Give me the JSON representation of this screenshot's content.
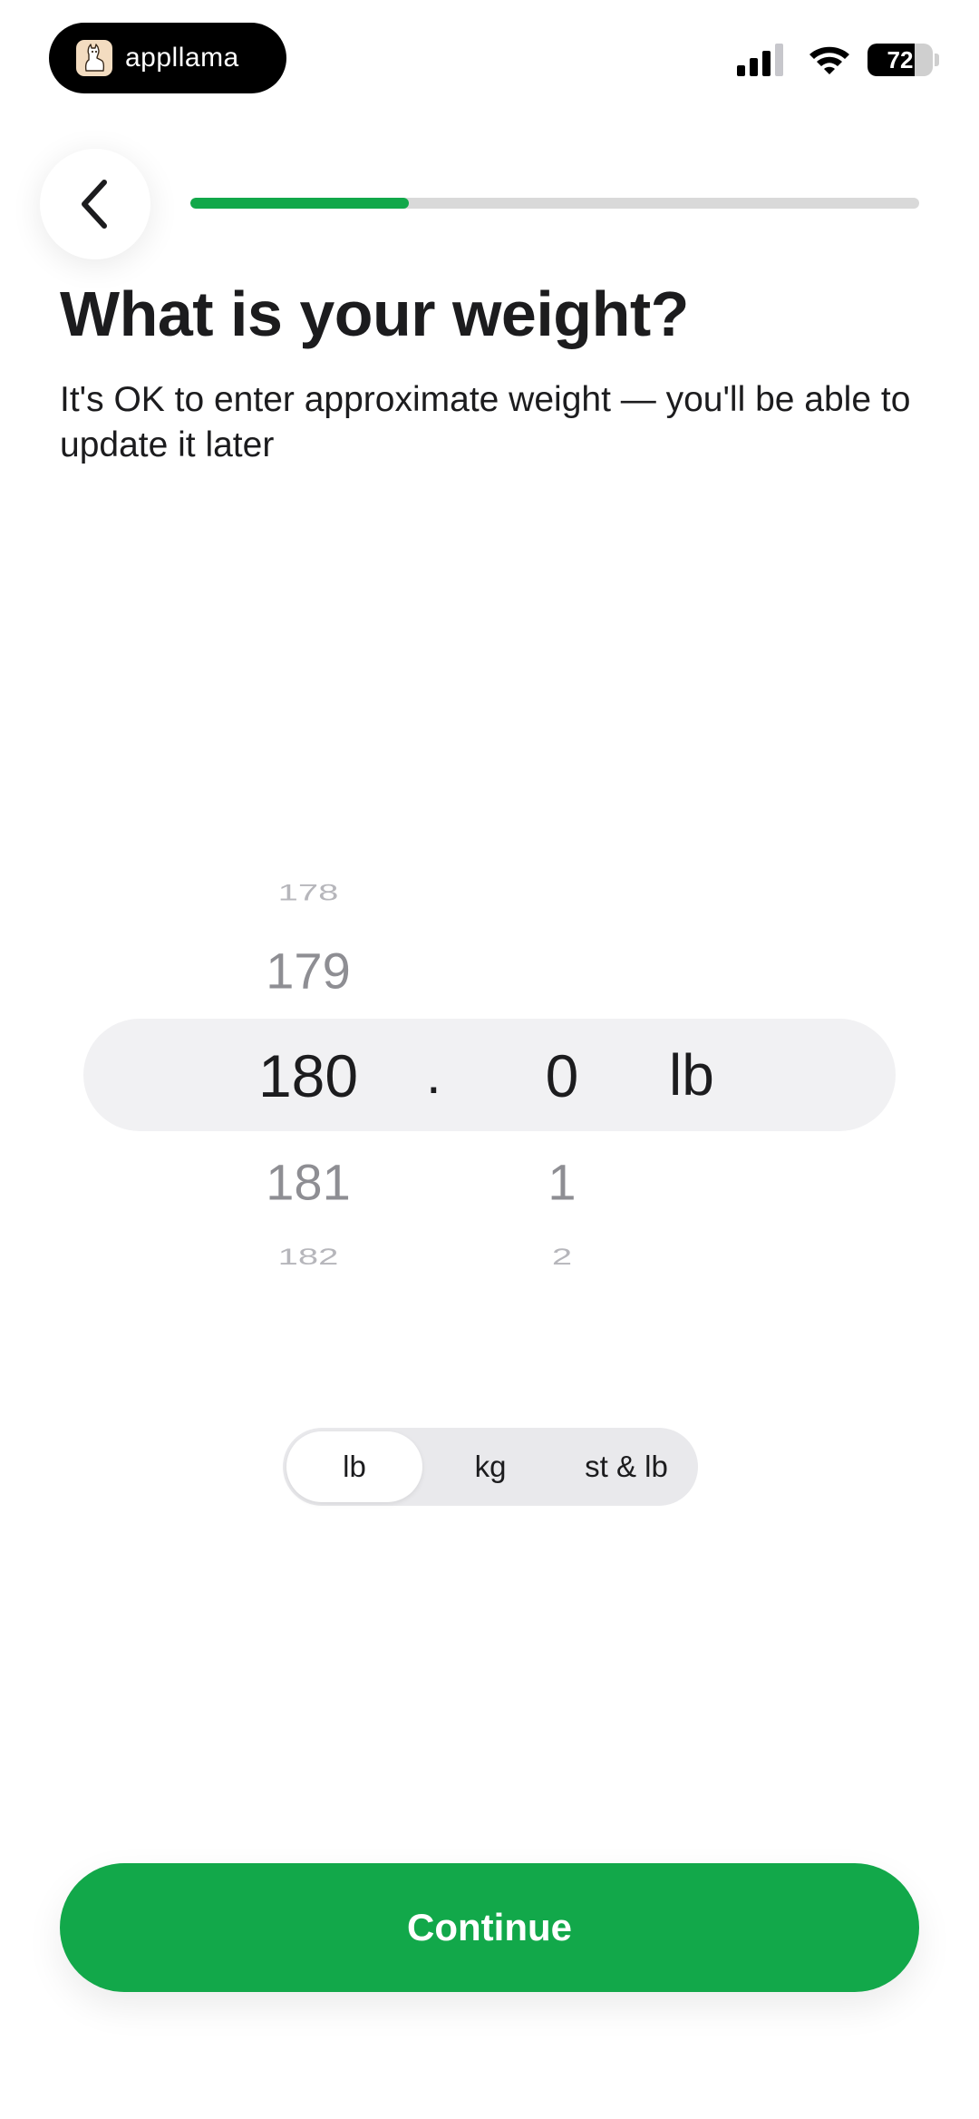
{
  "status_bar": {
    "app_badge": "appllama",
    "battery": "72",
    "battery_level_percent": 72,
    "icons": [
      "llama-logo-icon",
      "signal-icon",
      "wifi-icon",
      "battery-icon"
    ]
  },
  "header": {
    "back_icon": "chevron-left-icon",
    "progress_percent": 30
  },
  "title": "What is your weight?",
  "subtitle": "It's OK to enter approximate weight — you'll be able to update it later",
  "picker": {
    "integer": {
      "above_2": "178",
      "above_1": "179",
      "selected": "180",
      "below_1": "181",
      "below_2": "182"
    },
    "separator": ".",
    "decimal": {
      "selected": "0",
      "below_1": "1",
      "below_2": "2"
    },
    "unit": "lb"
  },
  "units": {
    "options": [
      "lb",
      "kg",
      "st & lb"
    ],
    "selected": "lb"
  },
  "continue_label": "Continue",
  "colors": {
    "accent": "#12a84a",
    "track": "#d9d9d9",
    "highlight": "#f1f1f3"
  }
}
